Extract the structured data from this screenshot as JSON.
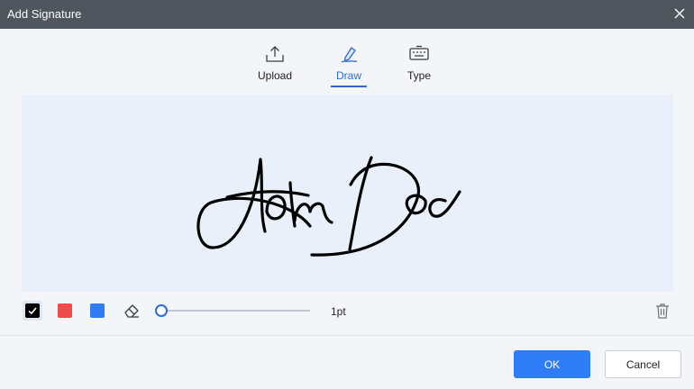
{
  "window": {
    "title": "Add Signature",
    "close_icon": "close-icon"
  },
  "tabs": [
    {
      "label": "Upload",
      "icon": "upload-icon",
      "active": false
    },
    {
      "label": "Draw",
      "icon": "draw-pen-icon",
      "active": true
    },
    {
      "label": "Type",
      "icon": "keyboard-icon",
      "active": false
    }
  ],
  "canvas": {
    "signature_text": "John Doe"
  },
  "toolbar": {
    "colors": [
      {
        "name": "black",
        "hex": "#000000",
        "selected": true
      },
      {
        "name": "red",
        "hex": "#ef4b4b",
        "selected": false
      },
      {
        "name": "blue",
        "hex": "#2f7df6",
        "selected": false
      }
    ],
    "eraser_icon": "eraser-icon",
    "thickness_label": "1pt",
    "thickness_level": 0,
    "trash_icon": "trash-icon"
  },
  "buttons": {
    "ok_label": "OK",
    "cancel_label": "Cancel"
  },
  "colors": {
    "accent": "#2e6ad1",
    "ok_button": "#2f7df6",
    "titlebar": "#50565e",
    "canvas_bg": "#eaf0fa"
  }
}
